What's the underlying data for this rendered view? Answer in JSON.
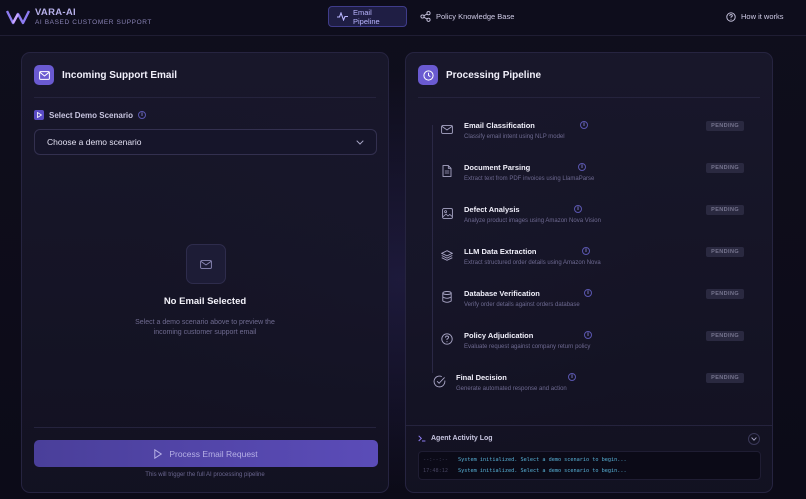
{
  "header": {
    "brand_name": "VARA-AI",
    "brand_sub": "AI BASED CUSTOMER SUPPORT",
    "tabs": [
      {
        "label": "Email Pipeline",
        "icon": "activity-icon",
        "active": true
      },
      {
        "label": "Policy Knowledge Base",
        "icon": "share-icon",
        "active": false
      }
    ],
    "how_label": "How it works"
  },
  "left": {
    "title": "Incoming Support Email",
    "scenario_label": "Select Demo Scenario",
    "select_placeholder": "Choose a demo scenario",
    "empty_title": "No Email Selected",
    "empty_desc": "Select a demo scenario above to preview the incoming customer support email",
    "button_label": "Process Email Request",
    "button_hint": "This will trigger the full AI processing pipeline"
  },
  "right": {
    "title": "Processing Pipeline",
    "steps": [
      {
        "title": "Email Classification",
        "desc": "Classify email intent using NLP model",
        "status": "PENDING",
        "icon": "mail-icon"
      },
      {
        "title": "Document Parsing",
        "desc": "Extract text from PDF invoices using LlamaParse",
        "status": "PENDING",
        "icon": "file-icon"
      },
      {
        "title": "Defect Analysis",
        "desc": "Analyze product images using Amazon Nova Vision",
        "status": "PENDING",
        "icon": "image-icon"
      },
      {
        "title": "LLM Data Extraction",
        "desc": "Extract structured order details using Amazon Nova",
        "status": "PENDING",
        "icon": "layers-icon"
      },
      {
        "title": "Database Verification",
        "desc": "Verify order details against orders database",
        "status": "PENDING",
        "icon": "database-icon"
      },
      {
        "title": "Policy Adjudication",
        "desc": "Evaluate request against company return policy",
        "status": "PENDING",
        "icon": "help-circle-icon"
      },
      {
        "title": "Final Decision",
        "desc": "Generate automated response and action",
        "status": "PENDING",
        "icon": "check-circle-icon"
      }
    ],
    "log_title": "Agent Activity Log",
    "log": [
      {
        "time": "--:--:--",
        "msg": "System initialized. Select a demo scenario to begin..."
      },
      {
        "time": "17:48:12",
        "msg": "System initialized. Select a demo scenario to begin..."
      }
    ]
  },
  "colors": {
    "accent": "#6a5ad1",
    "log_text": "#58b3d8"
  }
}
